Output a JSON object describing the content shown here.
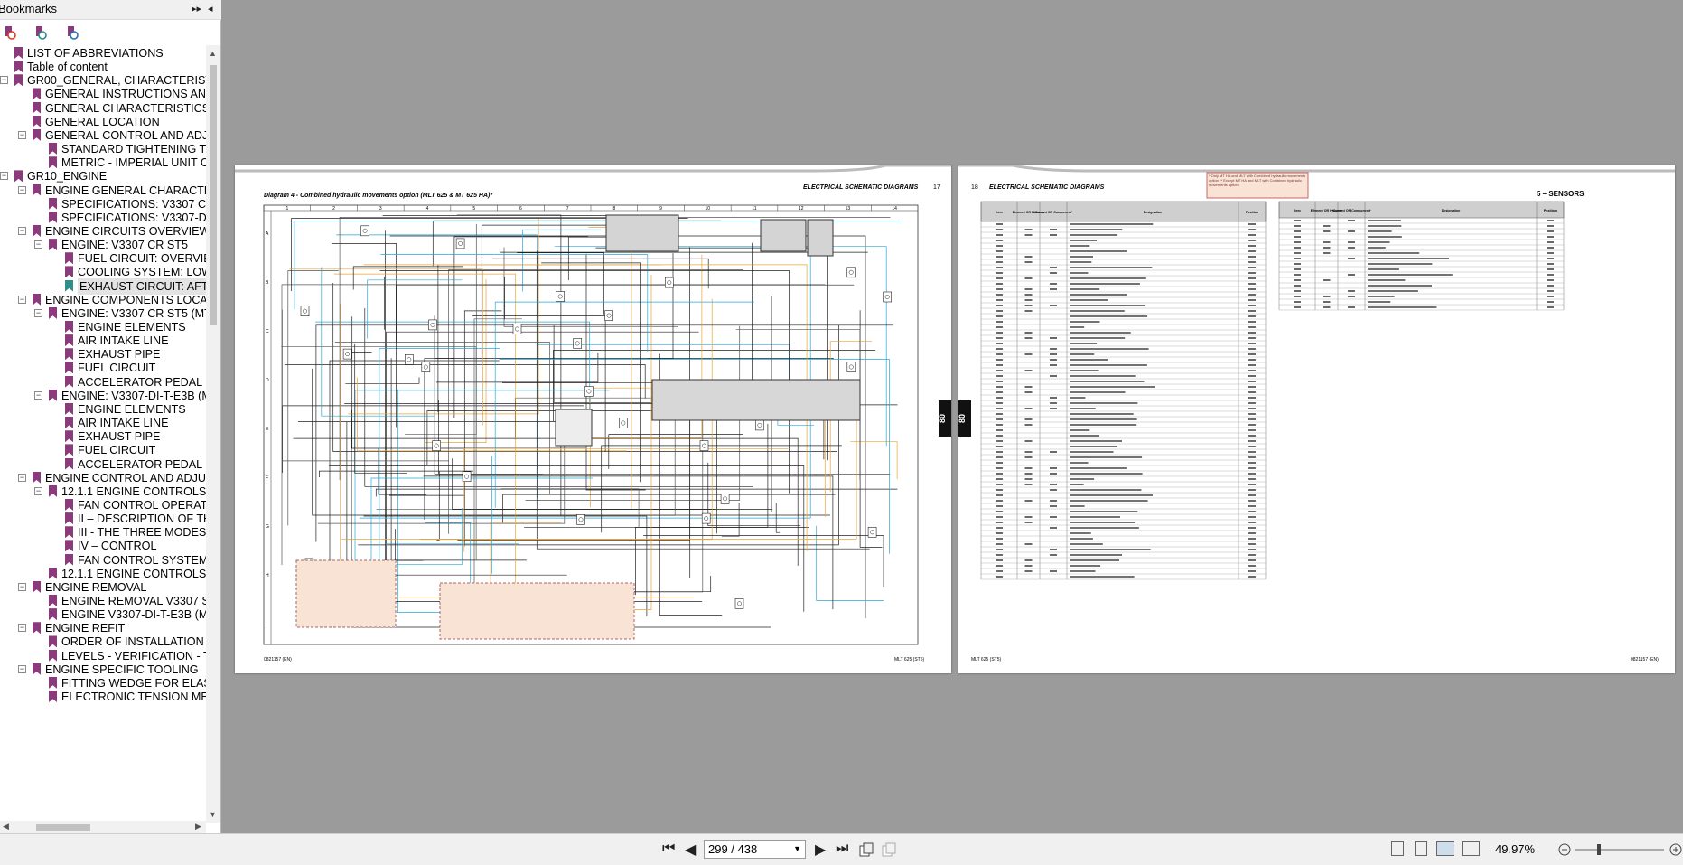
{
  "panel": {
    "title": "Bookmarks",
    "collapse_label": "▸▸",
    "close_label": "◂"
  },
  "bookmarks": [
    {
      "label": "LIST OF ABBREVIATIONS",
      "level": 0,
      "expand": ""
    },
    {
      "label": "Table of content",
      "level": 0,
      "expand": ""
    },
    {
      "label": "GR00_GENERAL, CHARACTERISTIC",
      "level": 0,
      "expand": "−"
    },
    {
      "label": "GENERAL INSTRUCTIONS AND",
      "level": 1,
      "expand": ""
    },
    {
      "label": "GENERAL CHARACTERISTICS A",
      "level": 1,
      "expand": ""
    },
    {
      "label": "GENERAL LOCATION",
      "level": 1,
      "expand": ""
    },
    {
      "label": "GENERAL CONTROL AND ADJUS",
      "level": 1,
      "expand": "−"
    },
    {
      "label": "STANDARD TIGHTENING TO",
      "level": 2,
      "expand": ""
    },
    {
      "label": "METRIC - IMPERIAL UNIT C",
      "level": 2,
      "expand": ""
    },
    {
      "label": "GR10_ENGINE",
      "level": 0,
      "expand": "−"
    },
    {
      "label": "ENGINE GENERAL CHARACTERI",
      "level": 1,
      "expand": "−"
    },
    {
      "label": "SPECIFICATIONS: V3307 CR",
      "level": 2,
      "expand": ""
    },
    {
      "label": "SPECIFICATIONS: V3307-DI",
      "level": 2,
      "expand": ""
    },
    {
      "label": "ENGINE CIRCUITS OVERVIEW",
      "level": 1,
      "expand": "−"
    },
    {
      "label": "ENGINE: V3307 CR ST5",
      "level": 2,
      "expand": "−"
    },
    {
      "label": "FUEL CIRCUIT: OVERVIE",
      "level": 3,
      "expand": ""
    },
    {
      "label": "COOLING SYSTEM: LOW",
      "level": 3,
      "expand": ""
    },
    {
      "label": "EXHAUST CIRCUIT: AFT",
      "level": 3,
      "expand": "",
      "selected": true
    },
    {
      "label": "ENGINE COMPONENTS LOCATI",
      "level": 1,
      "expand": "−"
    },
    {
      "label": "ENGINE: V3307 CR ST5 (MT",
      "level": 2,
      "expand": "−"
    },
    {
      "label": "ENGINE ELEMENTS",
      "level": 3,
      "expand": ""
    },
    {
      "label": "AIR INTAKE LINE",
      "level": 3,
      "expand": ""
    },
    {
      "label": "EXHAUST PIPE",
      "level": 3,
      "expand": ""
    },
    {
      "label": "FUEL CIRCUIT",
      "level": 3,
      "expand": ""
    },
    {
      "label": "ACCELERATOR PEDAL",
      "level": 3,
      "expand": ""
    },
    {
      "label": "ENGINE: V3307-DI-T-E3B (M",
      "level": 2,
      "expand": "−"
    },
    {
      "label": "ENGINE ELEMENTS",
      "level": 3,
      "expand": ""
    },
    {
      "label": "AIR INTAKE LINE",
      "level": 3,
      "expand": ""
    },
    {
      "label": "EXHAUST PIPE",
      "level": 3,
      "expand": ""
    },
    {
      "label": "FUEL CIRCUIT",
      "level": 3,
      "expand": ""
    },
    {
      "label": "ACCELERATOR PEDAL",
      "level": 3,
      "expand": ""
    },
    {
      "label": "ENGINE CONTROL AND ADJUST",
      "level": 1,
      "expand": "−"
    },
    {
      "label": "12.1.1 ENGINE CONTROLS A",
      "level": 2,
      "expand": "−"
    },
    {
      "label": "FAN CONTROL OPERATI",
      "level": 3,
      "expand": ""
    },
    {
      "label": "II – DESCRIPTION OF TH",
      "level": 3,
      "expand": ""
    },
    {
      "label": "III - THE THREE MODES",
      "level": 3,
      "expand": ""
    },
    {
      "label": "IV – CONTROL",
      "level": 3,
      "expand": ""
    },
    {
      "label": "FAN CONTROL SYSTEM",
      "level": 3,
      "expand": ""
    },
    {
      "label": "12.1.1 ENGINE CONTROLS A",
      "level": 2,
      "expand": ""
    },
    {
      "label": "ENGINE REMOVAL",
      "level": 1,
      "expand": "−"
    },
    {
      "label": "ENGINE REMOVAL V3307 ST",
      "level": 2,
      "expand": ""
    },
    {
      "label": "ENGINE V3307-DI-T-E3B (M",
      "level": 2,
      "expand": ""
    },
    {
      "label": "ENGINE REFIT",
      "level": 1,
      "expand": "−"
    },
    {
      "label": "ORDER OF INSTALLATION C",
      "level": 2,
      "expand": ""
    },
    {
      "label": "LEVELS - VERIFICATION - T",
      "level": 2,
      "expand": ""
    },
    {
      "label": "ENGINE SPECIFIC TOOLING",
      "level": 1,
      "expand": "−"
    },
    {
      "label": "FITTING WEDGE FOR ELAST",
      "level": 2,
      "expand": ""
    },
    {
      "label": "ELECTRONIC TENSION MET",
      "level": 2,
      "expand": ""
    }
  ],
  "left_page": {
    "header": "ELECTRICAL SCHEMATIC DIAGRAMS",
    "page_no": "17",
    "diagram_title": "Diagram 4 - Combined hydraulic movements option (MLT 625 & MT 625 HA)*",
    "col_labels": [
      "1",
      "2",
      "3",
      "4",
      "5",
      "6",
      "7",
      "8",
      "9",
      "10",
      "11",
      "12",
      "13",
      "14"
    ],
    "row_labels": [
      "A",
      "B",
      "C",
      "D",
      "E",
      "F",
      "G",
      "H",
      "I"
    ],
    "tab_label": "80",
    "footer_left": "0821157 (EN)",
    "footer_right": "MLT 625 (ST5)"
  },
  "right_page": {
    "header": "ELECTRICAL SCHEMATIC DIAGRAMS",
    "page_no": "18",
    "section_title": "5 – SENSORS",
    "tab_label": "80",
    "note": "* Only MT HA and MLT with Combined hydraulic movements option  ** Except MT HA and MLT with Combined hydraulic movements option",
    "table_headers": [
      "Item",
      "Element OR Harness",
      "*Current OR Component*",
      "Designation",
      "Position"
    ],
    "footer_left": "MLT 625 (ST5)",
    "footer_right": "0821157 (EN)"
  },
  "toolbar": {
    "page_value": "299 / 438",
    "zoom": "49.97%"
  }
}
